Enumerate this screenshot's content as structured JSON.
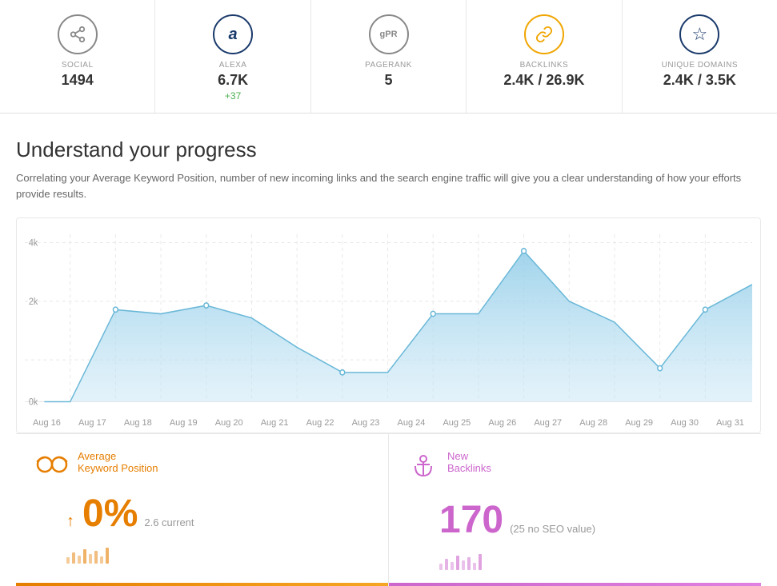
{
  "metrics": [
    {
      "id": "social",
      "icon": "share",
      "icon_unicode": "⤢",
      "label": "SOCIAL",
      "value": "1494",
      "sub": "",
      "icon_style": "social"
    },
    {
      "id": "alexa",
      "icon": "a",
      "icon_unicode": "a",
      "label": "ALEXA",
      "value": "6.7K",
      "sub": "+37",
      "icon_style": "alexa"
    },
    {
      "id": "pagerank",
      "icon": "gPR",
      "icon_unicode": "gPR",
      "label": "PAGERANK",
      "value": "5",
      "sub": "",
      "icon_style": "pagerank"
    },
    {
      "id": "backlinks",
      "icon": "link",
      "icon_unicode": "🔗",
      "label": "BACKLINKS",
      "value": "2.4K / 26.9K",
      "sub": "",
      "icon_style": "backlinks"
    },
    {
      "id": "unique_domains",
      "icon": "star",
      "icon_unicode": "☆",
      "label": "UNIQUE DOMAINS",
      "value": "2.4K / 3.5K",
      "sub": "",
      "icon_style": "unique"
    }
  ],
  "section": {
    "title": "Understand your progress",
    "description": "Correlating your Average Keyword Position, number of new incoming links and the search engine traffic will give you a clear understanding of how your efforts provide results."
  },
  "chart": {
    "y_labels": [
      "4k",
      "2k",
      "0k"
    ],
    "x_labels": [
      "Aug 16",
      "Aug 17",
      "Aug 18",
      "Aug 19",
      "Aug 20",
      "Aug 21",
      "Aug 22",
      "Aug 23",
      "Aug 24",
      "Aug 25",
      "Aug 26",
      "Aug 27",
      "Aug 28",
      "Aug 29",
      "Aug 30",
      "Aug 31"
    ]
  },
  "panels": {
    "left": {
      "icon": "👓",
      "title_line1": "Average",
      "title_line2": "Keyword Position",
      "arrow": "↑",
      "percentage": "0%",
      "current_label": "2.6 current"
    },
    "right": {
      "icon": "⚓",
      "title_line1": "New",
      "title_line2": "Backlinks",
      "value": "170",
      "note": "(25 no SEO value)"
    }
  }
}
